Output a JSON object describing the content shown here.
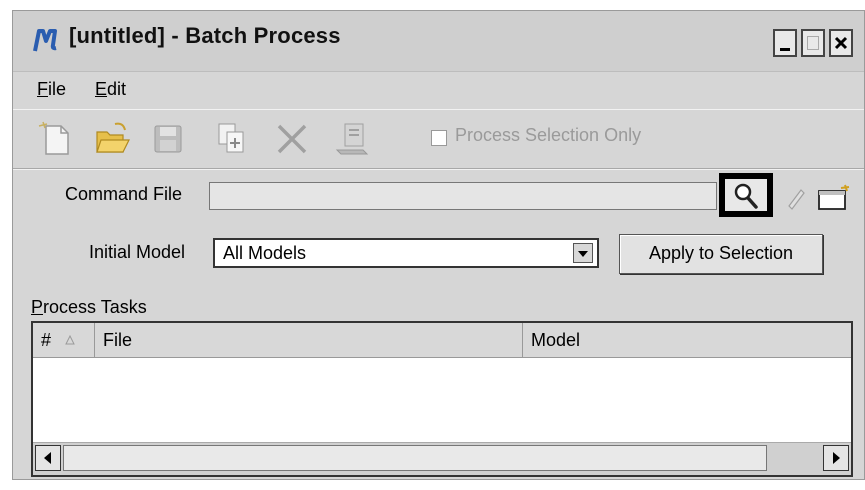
{
  "window": {
    "title": "[untitled] - Batch Process",
    "controls": {
      "minimize": "_",
      "maximize": "□",
      "close": "x"
    }
  },
  "menubar": {
    "items": [
      {
        "mnemonic": "F",
        "rest": "ile"
      },
      {
        "mnemonic": "E",
        "rest": "dit"
      }
    ]
  },
  "toolbar": {
    "icons": [
      "new-file-icon",
      "open-folder-icon",
      "save-icon",
      "copy-icon",
      "delete-icon",
      "process-icon"
    ],
    "process_selection_only": {
      "label": "Process Selection Only",
      "checked": false,
      "enabled": false
    }
  },
  "form": {
    "command_file": {
      "label": "Command File",
      "value": ""
    },
    "initial_model": {
      "label": "Initial Model",
      "value": "All Models"
    },
    "apply_button": "Apply to Selection"
  },
  "tasks": {
    "label_mnemonic": "P",
    "label_rest": "rocess Tasks",
    "columns": [
      "#",
      "File",
      "Model"
    ],
    "rows": []
  },
  "colors": {
    "window_bg": "#d6d6d6",
    "title_icon": "#2a5db0",
    "highlight_box": "#000000"
  }
}
